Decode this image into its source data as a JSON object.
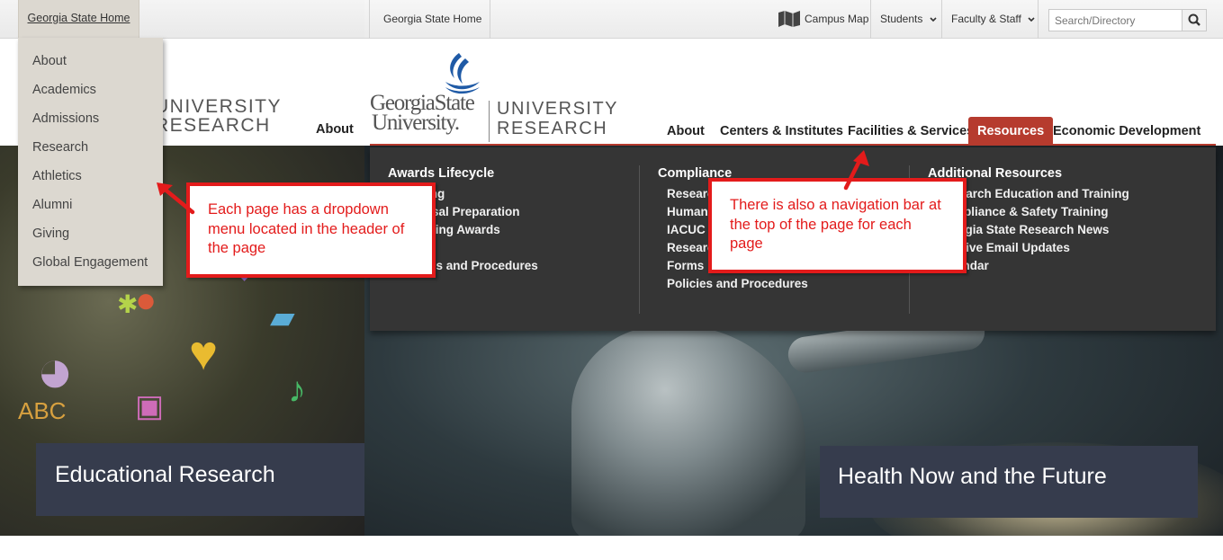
{
  "left_screen": {
    "topbar": {
      "home_link": "Georgia State Home"
    },
    "dropdown": {
      "items": [
        {
          "label": "About"
        },
        {
          "label": "Academics"
        },
        {
          "label": "Admissions"
        },
        {
          "label": "Research"
        },
        {
          "label": "Athletics"
        },
        {
          "label": "Alumni"
        },
        {
          "label": "Giving"
        },
        {
          "label": "Global Engagement"
        }
      ]
    },
    "logo_text_line1": "UNIVERSITY",
    "logo_text_line2": "RESEARCH",
    "nav_about": "About",
    "hero_caption": "Educational Research"
  },
  "right_screen": {
    "topbar": {
      "home_link": "Georgia State Home",
      "campus_map": "Campus Map",
      "students": "Students",
      "faculty_staff": "Faculty & Staff",
      "search_placeholder": "Search/Directory"
    },
    "logo": {
      "word1": "GeorgiaState",
      "word2": "University.",
      "unit_line1": "UNIVERSITY",
      "unit_line2": "RESEARCH"
    },
    "main_nav": [
      {
        "label": "About"
      },
      {
        "label": "Centers & Institutes"
      },
      {
        "label": "Facilities & Services"
      },
      {
        "label": "Resources",
        "active": true
      },
      {
        "label": "Economic Development"
      }
    ],
    "mega_menu": {
      "columns": [
        {
          "heading": "Awards Lifecycle",
          "items": [
            "Funding",
            "Proposal Preparation",
            "Managing Awards",
            "",
            "Policies and Procedures"
          ]
        },
        {
          "heading": "Compliance",
          "items": [
            "Research Integrity",
            "Human Subjects",
            "IACUC",
            "Research Safety",
            "Forms",
            "Policies and Procedures"
          ]
        },
        {
          "heading": "Additional Resources",
          "items": [
            "Research Education and Training",
            "Compliance & Safety Training",
            "Georgia State Research News",
            "Receive Email Updates",
            "Calendar"
          ]
        }
      ]
    },
    "hero_caption": "Health Now and the Future"
  },
  "annotations": {
    "left_callout": "Each page has a dropdown menu located in the header of the page",
    "right_callout": "There is also a navigation bar at the top of the page for each page"
  },
  "colors": {
    "accent_red": "#b63b2e",
    "callout_red": "#e31b1b",
    "caption_bg": "#363c4d",
    "mega_bg": "#353535",
    "gsu_blue": "#1f5aa6"
  },
  "icons": [
    "map-icon",
    "chevron-down-icon",
    "search-icon",
    "arrow-icon"
  ]
}
